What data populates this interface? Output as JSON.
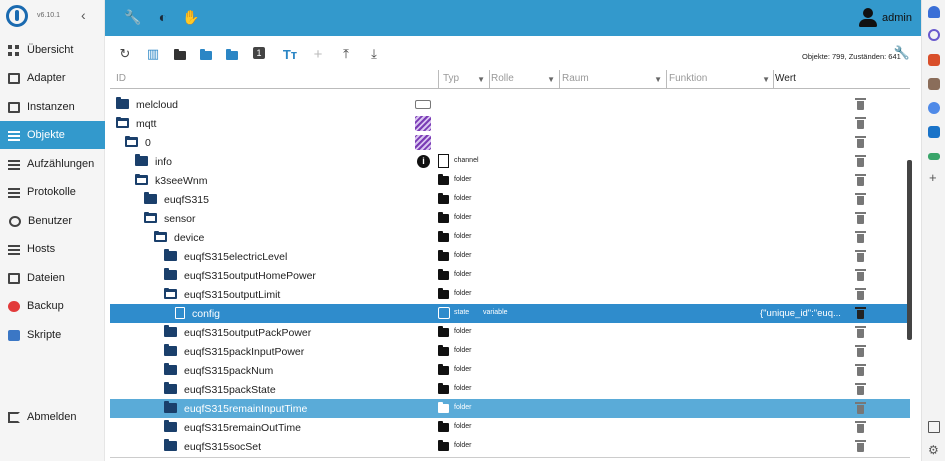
{
  "sidebar": {
    "version": "v6.10.1",
    "items": [
      {
        "label": "Übersicht",
        "icon": "grid-icon"
      },
      {
        "label": "Adapter",
        "icon": "store-icon"
      },
      {
        "label": "Instanzen",
        "icon": "instances-icon"
      },
      {
        "label": "Objekte",
        "icon": "list-icon",
        "active": true
      },
      {
        "label": "Aufzählungen",
        "icon": "enum-icon"
      },
      {
        "label": "Protokolle",
        "icon": "log-icon"
      },
      {
        "label": "Benutzer",
        "icon": "user-icon"
      },
      {
        "label": "Hosts",
        "icon": "hosts-icon"
      },
      {
        "label": "Dateien",
        "icon": "file-icon"
      },
      {
        "label": "Backup",
        "icon": "backup-icon"
      },
      {
        "label": "Skripte",
        "icon": "scripts-icon"
      }
    ],
    "logout": "Abmelden"
  },
  "header": {
    "user": "admin"
  },
  "toolbar": {
    "object_count": "Objekte: 799, Zuständen: 641"
  },
  "filters": {
    "id_placeholder": "ID",
    "type": "Typ",
    "role": "Rolle",
    "room": "Raum",
    "function": "Funktion",
    "value": "Wert"
  },
  "tree": {
    "rows": [
      {
        "label": "melcloud",
        "type": "",
        "role": "",
        "value": ""
      },
      {
        "label": "mqtt",
        "type": "",
        "role": "",
        "value": ""
      },
      {
        "label": "0",
        "type": "",
        "role": "",
        "value": ""
      },
      {
        "label": "info",
        "type": "channel",
        "role": "",
        "value": ""
      },
      {
        "label": "k3seeWnm",
        "type": "folder",
        "role": "",
        "value": ""
      },
      {
        "label": "euqfS315",
        "type": "folder",
        "role": "",
        "value": ""
      },
      {
        "label": "sensor",
        "type": "folder",
        "role": "",
        "value": ""
      },
      {
        "label": "device",
        "type": "folder",
        "role": "",
        "value": ""
      },
      {
        "label": "euqfS315electricLevel",
        "type": "folder",
        "role": "",
        "value": ""
      },
      {
        "label": "euqfS315outputHomePower",
        "type": "folder",
        "role": "",
        "value": ""
      },
      {
        "label": "euqfS315outputLimit",
        "type": "folder",
        "role": "",
        "value": ""
      },
      {
        "label": "config",
        "type": "state",
        "role": "variable",
        "value": "{\"unique_id\":\"euq..."
      },
      {
        "label": "euqfS315outputPackPower",
        "type": "folder",
        "role": "",
        "value": ""
      },
      {
        "label": "euqfS315packInputPower",
        "type": "folder",
        "role": "",
        "value": ""
      },
      {
        "label": "euqfS315packNum",
        "type": "folder",
        "role": "",
        "value": ""
      },
      {
        "label": "euqfS315packState",
        "type": "folder",
        "role": "",
        "value": ""
      },
      {
        "label": "euqfS315remainInputTime",
        "type": "folder",
        "role": "",
        "value": ""
      },
      {
        "label": "euqfS315remainOutTime",
        "type": "folder",
        "role": "",
        "value": ""
      },
      {
        "label": "euqfS315socSet",
        "type": "folder",
        "role": "",
        "value": ""
      }
    ]
  },
  "colors": {
    "accent": "#3399cc",
    "selected": "#2f8ccc",
    "highlight": "#5aabd8",
    "folder": "#1a3f6b"
  }
}
